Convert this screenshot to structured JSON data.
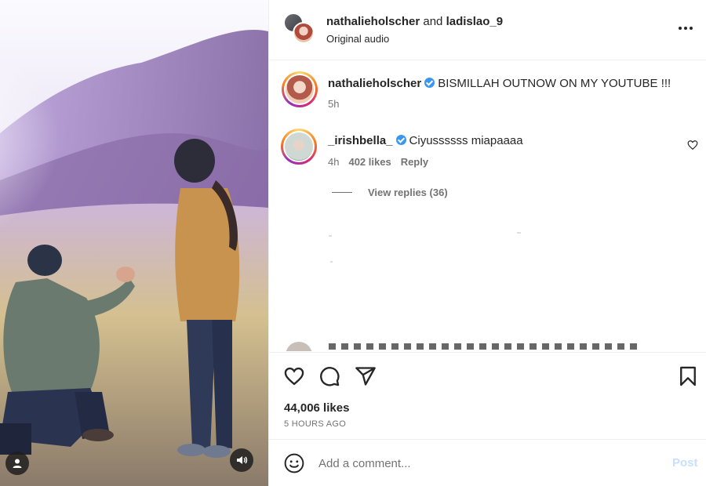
{
  "header": {
    "user_a": "nathalieholscher",
    "conjunction": "and",
    "user_b": "ladislao_9",
    "audio": "Original audio"
  },
  "caption": {
    "username": "nathalieholscher",
    "text": "BISMILLAH OUTNOW ON MY YOUTUBE !!!",
    "time": "5h"
  },
  "comments": [
    {
      "username": "_irishbella_",
      "text": "Ciyussssss miapaaaa",
      "time": "4h",
      "likes": "402 likes",
      "reply_label": "Reply",
      "view_replies": "View replies (36)"
    }
  ],
  "actions": {
    "likes": "44,006 likes",
    "time_ago": "5 HOURS AGO"
  },
  "add_comment": {
    "placeholder": "Add a comment...",
    "post_label": "Post"
  },
  "icons": {
    "more": "more-horizontal-icon",
    "like": "heart-icon",
    "comment": "comment-icon",
    "share": "send-icon",
    "save": "bookmark-icon",
    "emoji": "emoji-icon",
    "tag": "user-tag-icon",
    "sound": "speaker-icon"
  },
  "colors": {
    "verified": "#3897f0",
    "post_disabled": "#c7e0fd",
    "secondary_text": "#737373"
  }
}
